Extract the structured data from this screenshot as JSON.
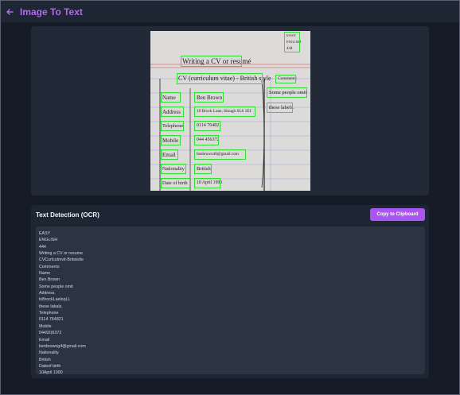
{
  "header": {
    "back_icon": "arrow-left-icon",
    "title": "Image To Text"
  },
  "image": {
    "lines": [
      "EASY",
      "ENGLISH",
      "444",
      "Writing a CV or resumé",
      "CV (curriculum vitae) - British style",
      "Comments",
      "Name",
      "Ben Brown",
      "Some people omit",
      "Address",
      "10 Brock Lane, Slough SL6 1EJ",
      "these labels.",
      "Telephone",
      "0114 764821",
      "Mobile",
      "044 456372",
      "Email",
      "benbrown46@gmail.com",
      "Nationality",
      "British",
      "Date of birth",
      "10 April 1990"
    ]
  },
  "ocr": {
    "title": "Text Detection (OCR)",
    "copy_label": "Copy to Clipboard",
    "lines": [
      "EASY",
      "ENGLISH",
      "444",
      "Writing a CV or resume",
      "CVCurlculmvit-Britstotle",
      "Comments",
      "Name",
      "Ben Brown",
      "Some people omit",
      "Address.",
      "loBrockLaeloqLL",
      "these labals.",
      "Telephone",
      "0114 764821",
      "Mobile",
      "04492(6372",
      "Email",
      "benbrowng4@gmail.com",
      "Nationality",
      "British",
      "Dateof birth",
      "10April 1990"
    ]
  },
  "colors": {
    "accent": "#a955f2",
    "background": "#151b27",
    "card": "#1e2533",
    "text_box": "#2c3444",
    "detection_box": "#33dd33"
  }
}
